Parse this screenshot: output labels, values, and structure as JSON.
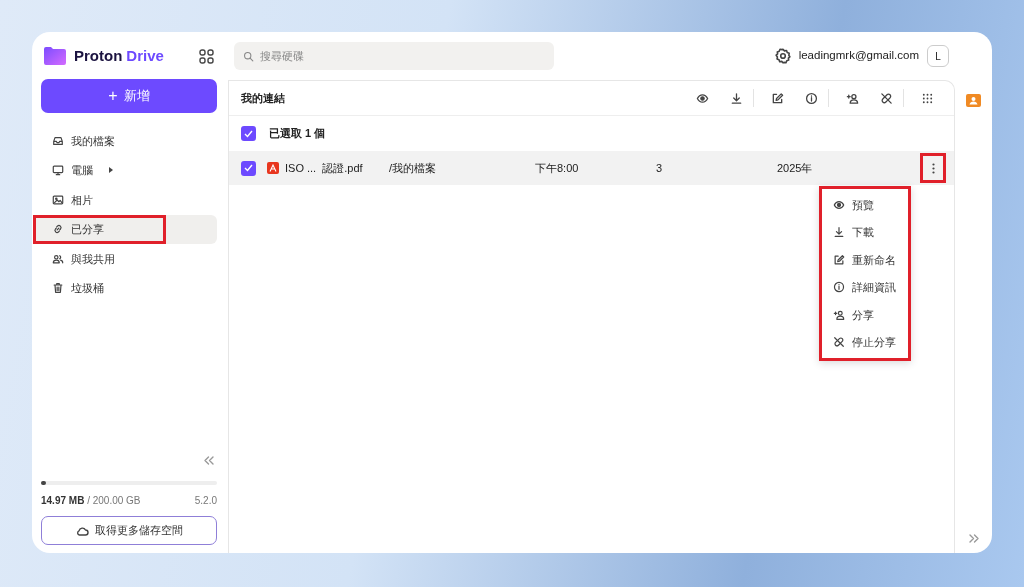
{
  "brand": {
    "name": "Proton",
    "product": "Drive"
  },
  "new_button": {
    "icon": "+",
    "label": "新增"
  },
  "sidebar": {
    "items": [
      {
        "kind": "inbox",
        "label": "我的檔案",
        "selected": false,
        "highlighted": false,
        "has_submenu": false
      },
      {
        "kind": "monitor",
        "label": "電腦",
        "selected": false,
        "highlighted": false,
        "has_submenu": true
      },
      {
        "kind": "image",
        "label": "相片",
        "selected": false,
        "highlighted": false,
        "has_submenu": false
      },
      {
        "kind": "link",
        "label": "已分享",
        "selected": true,
        "highlighted": true,
        "has_submenu": false
      },
      {
        "kind": "users",
        "label": "與我共用",
        "selected": false,
        "highlighted": false,
        "has_submenu": false
      },
      {
        "kind": "trash",
        "label": "垃圾桶",
        "selected": false,
        "highlighted": false,
        "has_submenu": false
      }
    ]
  },
  "storage": {
    "level": 0.03,
    "used": "14.97 MB",
    "total": " / 200.00 GB",
    "version": "5.2.0",
    "button": "取得更多儲存空間"
  },
  "search": {
    "placeholder": "搜尋硬碟"
  },
  "account": {
    "email": "leadingmrk@gmail.com",
    "initial": "L"
  },
  "toolbar": {
    "title": "我的連結",
    "actions": [
      {
        "kind": "eye",
        "separated": false
      },
      {
        "kind": "download",
        "separated": false
      },
      {
        "kind": "edit",
        "separated": true
      },
      {
        "kind": "info",
        "separated": false
      },
      {
        "kind": "share",
        "separated": true
      },
      {
        "kind": "unlink",
        "separated": false
      },
      {
        "kind": "grid",
        "separated": true
      }
    ]
  },
  "selection": {
    "checked": true,
    "label": "已選取 ",
    "count": "1",
    "unit": " 個"
  },
  "rows": [
    {
      "checked": true,
      "selected": true,
      "name": "ISO ...  認證.pdf",
      "location": "/我的檔案",
      "time": "下午8:00",
      "count": "3",
      "date": "2025年",
      "more_highlighted": true
    }
  ],
  "context_menu": {
    "highlighted": true,
    "items": [
      {
        "kind": "eye",
        "label": "預覽"
      },
      {
        "kind": "download",
        "label": "下載"
      },
      {
        "kind": "edit",
        "label": "重新命名"
      },
      {
        "kind": "info",
        "label": "詳細資訊"
      },
      {
        "kind": "share",
        "label": "分享"
      },
      {
        "kind": "unlink",
        "label": "停止分享"
      }
    ]
  }
}
